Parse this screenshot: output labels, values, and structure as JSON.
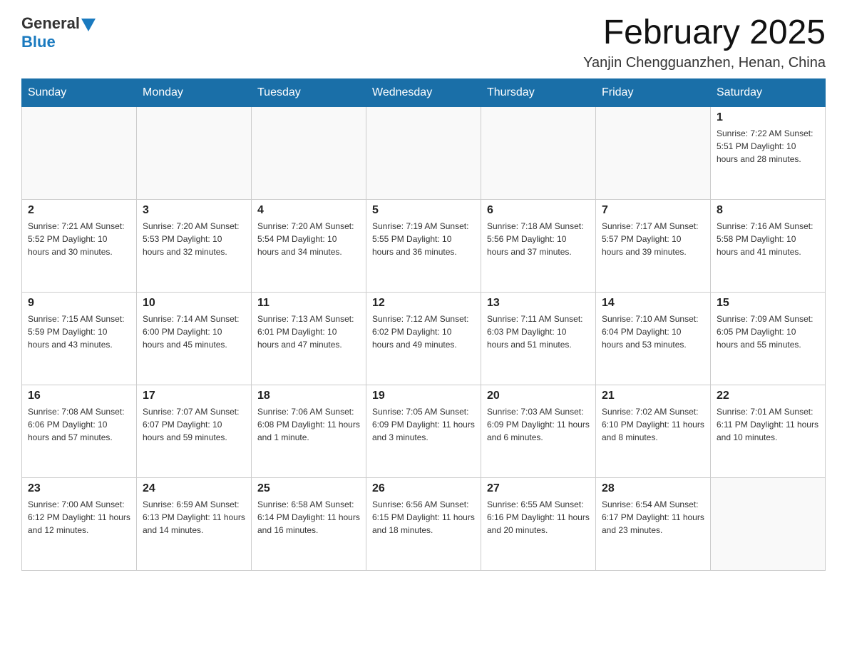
{
  "header": {
    "logo": {
      "general": "General",
      "blue": "Blue"
    },
    "title": "February 2025",
    "location": "Yanjin Chengguanzhen, Henan, China"
  },
  "days_of_week": [
    "Sunday",
    "Monday",
    "Tuesday",
    "Wednesday",
    "Thursday",
    "Friday",
    "Saturday"
  ],
  "weeks": [
    [
      {
        "day": "",
        "info": ""
      },
      {
        "day": "",
        "info": ""
      },
      {
        "day": "",
        "info": ""
      },
      {
        "day": "",
        "info": ""
      },
      {
        "day": "",
        "info": ""
      },
      {
        "day": "",
        "info": ""
      },
      {
        "day": "1",
        "info": "Sunrise: 7:22 AM\nSunset: 5:51 PM\nDaylight: 10 hours and 28 minutes."
      }
    ],
    [
      {
        "day": "2",
        "info": "Sunrise: 7:21 AM\nSunset: 5:52 PM\nDaylight: 10 hours and 30 minutes."
      },
      {
        "day": "3",
        "info": "Sunrise: 7:20 AM\nSunset: 5:53 PM\nDaylight: 10 hours and 32 minutes."
      },
      {
        "day": "4",
        "info": "Sunrise: 7:20 AM\nSunset: 5:54 PM\nDaylight: 10 hours and 34 minutes."
      },
      {
        "day": "5",
        "info": "Sunrise: 7:19 AM\nSunset: 5:55 PM\nDaylight: 10 hours and 36 minutes."
      },
      {
        "day": "6",
        "info": "Sunrise: 7:18 AM\nSunset: 5:56 PM\nDaylight: 10 hours and 37 minutes."
      },
      {
        "day": "7",
        "info": "Sunrise: 7:17 AM\nSunset: 5:57 PM\nDaylight: 10 hours and 39 minutes."
      },
      {
        "day": "8",
        "info": "Sunrise: 7:16 AM\nSunset: 5:58 PM\nDaylight: 10 hours and 41 minutes."
      }
    ],
    [
      {
        "day": "9",
        "info": "Sunrise: 7:15 AM\nSunset: 5:59 PM\nDaylight: 10 hours and 43 minutes."
      },
      {
        "day": "10",
        "info": "Sunrise: 7:14 AM\nSunset: 6:00 PM\nDaylight: 10 hours and 45 minutes."
      },
      {
        "day": "11",
        "info": "Sunrise: 7:13 AM\nSunset: 6:01 PM\nDaylight: 10 hours and 47 minutes."
      },
      {
        "day": "12",
        "info": "Sunrise: 7:12 AM\nSunset: 6:02 PM\nDaylight: 10 hours and 49 minutes."
      },
      {
        "day": "13",
        "info": "Sunrise: 7:11 AM\nSunset: 6:03 PM\nDaylight: 10 hours and 51 minutes."
      },
      {
        "day": "14",
        "info": "Sunrise: 7:10 AM\nSunset: 6:04 PM\nDaylight: 10 hours and 53 minutes."
      },
      {
        "day": "15",
        "info": "Sunrise: 7:09 AM\nSunset: 6:05 PM\nDaylight: 10 hours and 55 minutes."
      }
    ],
    [
      {
        "day": "16",
        "info": "Sunrise: 7:08 AM\nSunset: 6:06 PM\nDaylight: 10 hours and 57 minutes."
      },
      {
        "day": "17",
        "info": "Sunrise: 7:07 AM\nSunset: 6:07 PM\nDaylight: 10 hours and 59 minutes."
      },
      {
        "day": "18",
        "info": "Sunrise: 7:06 AM\nSunset: 6:08 PM\nDaylight: 11 hours and 1 minute."
      },
      {
        "day": "19",
        "info": "Sunrise: 7:05 AM\nSunset: 6:09 PM\nDaylight: 11 hours and 3 minutes."
      },
      {
        "day": "20",
        "info": "Sunrise: 7:03 AM\nSunset: 6:09 PM\nDaylight: 11 hours and 6 minutes."
      },
      {
        "day": "21",
        "info": "Sunrise: 7:02 AM\nSunset: 6:10 PM\nDaylight: 11 hours and 8 minutes."
      },
      {
        "day": "22",
        "info": "Sunrise: 7:01 AM\nSunset: 6:11 PM\nDaylight: 11 hours and 10 minutes."
      }
    ],
    [
      {
        "day": "23",
        "info": "Sunrise: 7:00 AM\nSunset: 6:12 PM\nDaylight: 11 hours and 12 minutes."
      },
      {
        "day": "24",
        "info": "Sunrise: 6:59 AM\nSunset: 6:13 PM\nDaylight: 11 hours and 14 minutes."
      },
      {
        "day": "25",
        "info": "Sunrise: 6:58 AM\nSunset: 6:14 PM\nDaylight: 11 hours and 16 minutes."
      },
      {
        "day": "26",
        "info": "Sunrise: 6:56 AM\nSunset: 6:15 PM\nDaylight: 11 hours and 18 minutes."
      },
      {
        "day": "27",
        "info": "Sunrise: 6:55 AM\nSunset: 6:16 PM\nDaylight: 11 hours and 20 minutes."
      },
      {
        "day": "28",
        "info": "Sunrise: 6:54 AM\nSunset: 6:17 PM\nDaylight: 11 hours and 23 minutes."
      },
      {
        "day": "",
        "info": ""
      }
    ]
  ]
}
